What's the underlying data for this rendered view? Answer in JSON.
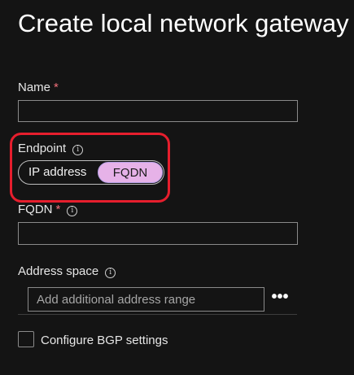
{
  "page": {
    "title": "Create local network gateway"
  },
  "name_field": {
    "label": "Name",
    "required_mark": "*",
    "value": "",
    "placeholder": ""
  },
  "endpoint": {
    "label": "Endpoint",
    "info_icon": "info-icon",
    "options": [
      "IP address",
      "FQDN"
    ],
    "selected": "FQDN",
    "selected_color": "#e6b2e8",
    "highlight_color": "#e61e2d"
  },
  "fqdn_field": {
    "label": "FQDN",
    "required_mark": "*",
    "value": "",
    "placeholder": ""
  },
  "address_space": {
    "label": "Address space",
    "info_icon": "info-icon",
    "placeholder": "Add additional address range",
    "more_icon": "ellipsis-icon",
    "more_label": "•••"
  },
  "bgp": {
    "label": "Configure BGP settings",
    "checked": false
  },
  "colors": {
    "background": "#141414",
    "required": "#f1707b",
    "border": "#8a8a8a"
  }
}
